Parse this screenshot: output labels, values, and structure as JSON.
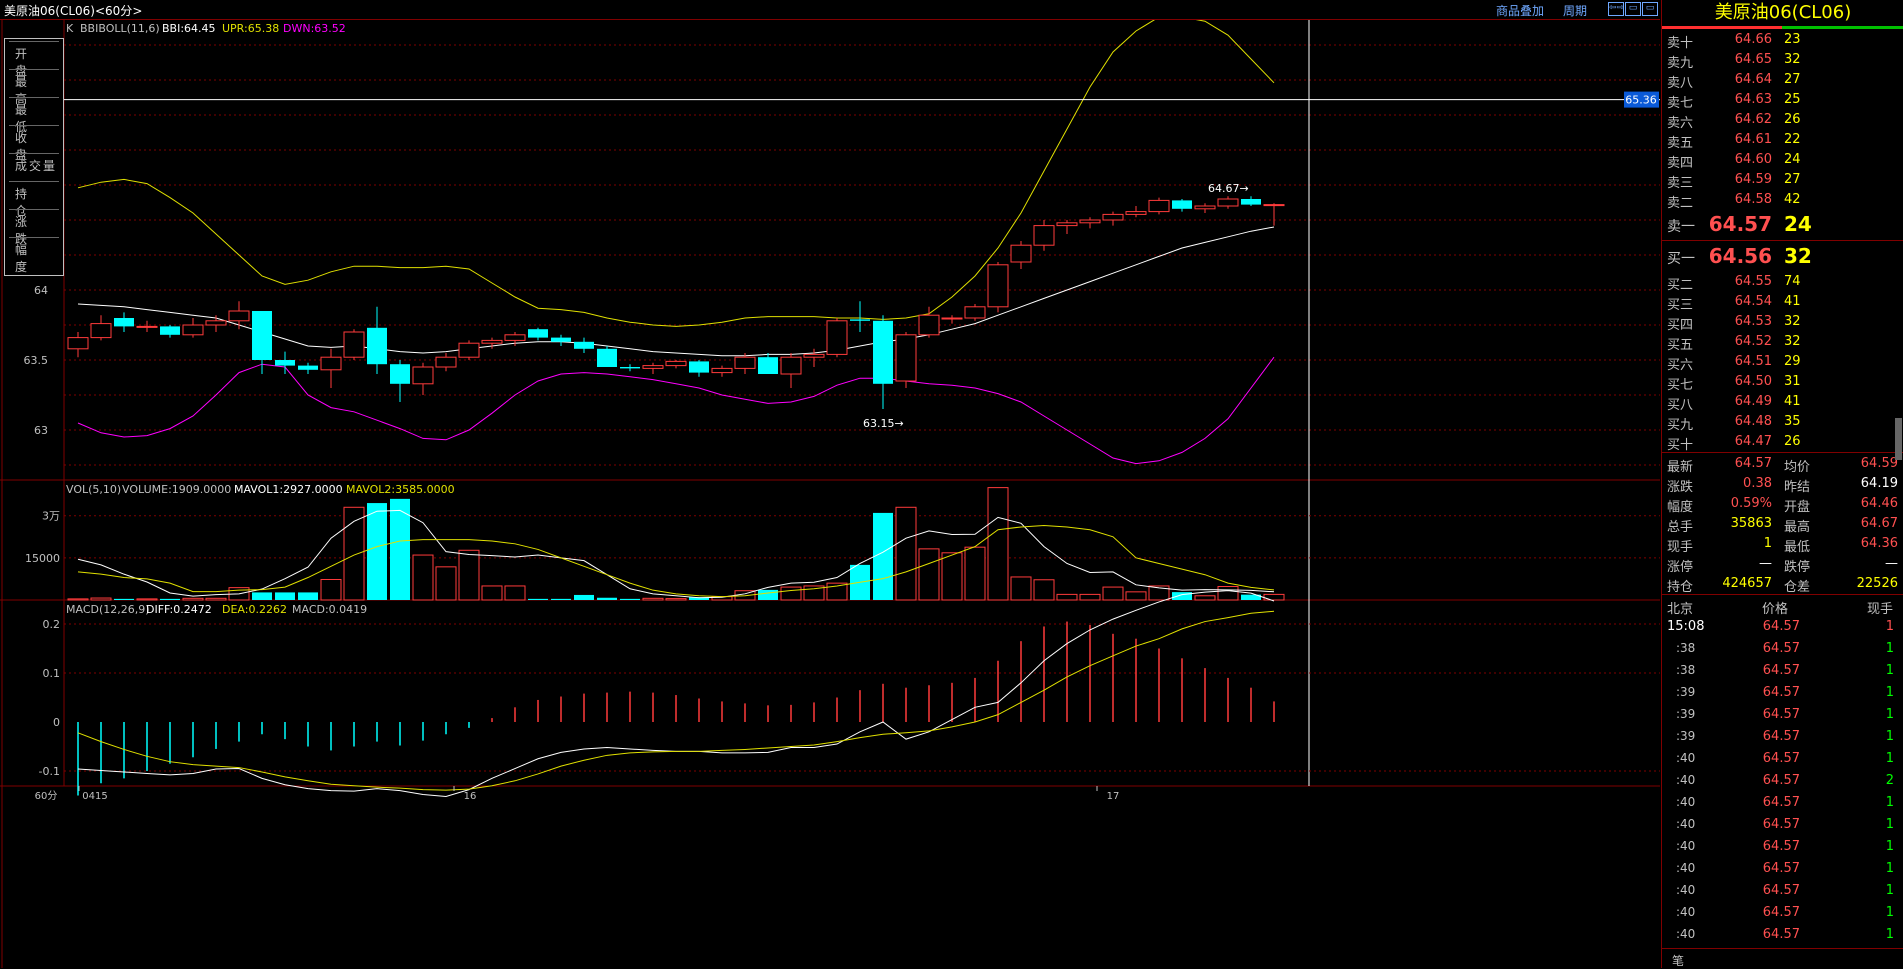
{
  "window": {
    "title": "美原油06(CL06)",
    "period": "60分",
    "overlay_label": "商品叠加",
    "cycle_label": "周期",
    "buttons": [
      "⇦⇨",
      "▭",
      "▭"
    ]
  },
  "infobox": [
    "开 盘",
    "最 高",
    "最 低",
    "收 盘",
    "成交量",
    "持 仓",
    "涨 跌",
    "幅 度"
  ],
  "indicators": {
    "main": {
      "name": "K",
      "sub": "BBIBOLL(11,6)",
      "bbi": "BBI:64.45",
      "upr": "UPR:65.38",
      "dwn": "DWN:63.52"
    },
    "vol": {
      "text": "VOL(5,10)",
      "volume": "VOLUME:1909.0000",
      "m1": "MAVOL1:2927.0000",
      "m2": "MAVOL2:3585.0000"
    },
    "macd": {
      "text": "MACD(12,26,9)",
      "diff": "DIFF:0.2472",
      "dea": "DEA:0.2262",
      "macd": "MACD:0.0419"
    }
  },
  "colors": {
    "up": "#ff3b3b",
    "down": "#00ffff",
    "bbi": "#ffffff",
    "upr": "#e0e000",
    "dwn": "#ff00ff",
    "grid": "#800000"
  },
  "chart_data": [
    {
      "type": "candlestick",
      "title": "美原油06(CL06) 60分",
      "xlabel": "",
      "ylabel": "",
      "x_tick_labels": [
        "0415",
        "16",
        "17"
      ],
      "period_label": "60分",
      "y_ticks": [
        63.0,
        63.5,
        64.0
      ],
      "ylim": [
        62.65,
        65.95
      ],
      "crosshair_value": "65.36",
      "annotations": [
        {
          "text": "64.67→",
          "x_index": 50,
          "value": 64.67
        },
        {
          "text": "63.15→",
          "x_index": 35,
          "value": 63.15
        }
      ],
      "candles": [
        [
          63.58,
          63.7,
          63.52,
          63.66
        ],
        [
          63.66,
          63.82,
          63.64,
          63.76
        ],
        [
          63.8,
          63.84,
          63.7,
          63.74
        ],
        [
          63.74,
          63.78,
          63.7,
          63.74
        ],
        [
          63.74,
          63.75,
          63.66,
          63.68
        ],
        [
          63.68,
          63.8,
          63.66,
          63.75
        ],
        [
          63.75,
          63.82,
          63.7,
          63.78
        ],
        [
          63.78,
          63.92,
          63.72,
          63.85
        ],
        [
          63.85,
          63.85,
          63.4,
          63.5
        ],
        [
          63.5,
          63.56,
          63.4,
          63.46
        ],
        [
          63.46,
          63.48,
          63.4,
          63.43
        ],
        [
          63.43,
          63.58,
          63.3,
          63.52
        ],
        [
          63.52,
          63.72,
          63.5,
          63.7
        ],
        [
          63.73,
          63.88,
          63.4,
          63.47
        ],
        [
          63.47,
          63.5,
          63.2,
          63.33
        ],
        [
          63.33,
          63.48,
          63.25,
          63.45
        ],
        [
          63.45,
          63.55,
          63.42,
          63.52
        ],
        [
          63.52,
          63.64,
          63.5,
          63.62
        ],
        [
          63.62,
          63.66,
          63.58,
          63.64
        ],
        [
          63.64,
          63.7,
          63.6,
          63.68
        ],
        [
          63.72,
          63.73,
          63.64,
          63.66
        ],
        [
          63.66,
          63.68,
          63.6,
          63.63
        ],
        [
          63.63,
          63.66,
          63.55,
          63.58
        ],
        [
          63.58,
          63.6,
          63.45,
          63.45
        ],
        [
          63.45,
          63.47,
          63.42,
          63.44
        ],
        [
          63.44,
          63.48,
          63.4,
          63.46
        ],
        [
          63.46,
          63.5,
          63.44,
          63.49
        ],
        [
          63.49,
          63.5,
          63.38,
          63.41
        ],
        [
          63.41,
          63.46,
          63.38,
          63.44
        ],
        [
          63.44,
          63.55,
          63.4,
          63.52
        ],
        [
          63.52,
          63.55,
          63.4,
          63.4
        ],
        [
          63.4,
          63.55,
          63.3,
          63.52
        ],
        [
          63.52,
          63.58,
          63.45,
          63.54
        ],
        [
          63.54,
          63.8,
          63.52,
          63.78
        ],
        [
          63.79,
          63.92,
          63.7,
          63.78
        ],
        [
          63.78,
          63.82,
          63.15,
          63.33
        ],
        [
          63.35,
          63.7,
          63.3,
          63.68
        ],
        [
          63.68,
          63.88,
          63.66,
          63.82
        ],
        [
          63.8,
          63.82,
          63.76,
          63.8
        ],
        [
          63.8,
          63.9,
          63.78,
          63.88
        ],
        [
          63.88,
          64.2,
          63.84,
          64.18
        ],
        [
          64.2,
          64.35,
          64.15,
          64.32
        ],
        [
          64.32,
          64.5,
          64.28,
          64.46
        ],
        [
          64.46,
          64.5,
          64.4,
          64.48
        ],
        [
          64.48,
          64.52,
          64.44,
          64.5
        ],
        [
          64.5,
          64.56,
          64.46,
          64.54
        ],
        [
          64.54,
          64.6,
          64.52,
          64.56
        ],
        [
          64.56,
          64.66,
          64.54,
          64.64
        ],
        [
          64.64,
          64.65,
          64.56,
          64.58
        ],
        [
          64.58,
          64.62,
          64.55,
          64.6
        ],
        [
          64.6,
          64.67,
          64.58,
          64.65
        ],
        [
          64.65,
          64.67,
          64.6,
          64.61
        ],
        [
          64.61,
          64.62,
          64.46,
          64.61
        ]
      ],
      "bbi": [
        63.9,
        63.89,
        63.88,
        63.86,
        63.84,
        63.82,
        63.8,
        63.75,
        63.7,
        63.65,
        63.6,
        63.59,
        63.6,
        63.58,
        63.56,
        63.55,
        63.56,
        63.58,
        63.6,
        63.62,
        63.63,
        63.63,
        63.62,
        63.6,
        63.58,
        63.56,
        63.55,
        63.54,
        63.53,
        63.53,
        63.54,
        63.54,
        63.55,
        63.57,
        63.6,
        63.63,
        63.65,
        63.68,
        63.72,
        63.76,
        63.82,
        63.88,
        63.94,
        64.0,
        64.06,
        64.12,
        64.18,
        64.24,
        64.3,
        64.34,
        64.38,
        64.42,
        64.45
      ],
      "upr": [
        64.73,
        64.77,
        64.79,
        64.76,
        64.66,
        64.55,
        64.4,
        64.25,
        64.1,
        64.04,
        64.07,
        64.13,
        64.17,
        64.17,
        64.16,
        64.16,
        64.17,
        64.15,
        64.05,
        63.95,
        63.87,
        63.86,
        63.84,
        63.8,
        63.77,
        63.75,
        63.74,
        63.75,
        63.77,
        63.8,
        63.81,
        63.81,
        63.81,
        63.8,
        63.8,
        63.79,
        63.8,
        63.83,
        63.95,
        64.1,
        64.3,
        64.55,
        64.85,
        65.15,
        65.45,
        65.7,
        65.85,
        65.95,
        65.95,
        65.92,
        65.82,
        65.65,
        65.48
      ],
      "dwn": [
        63.05,
        62.98,
        62.95,
        62.96,
        63.01,
        63.1,
        63.25,
        63.41,
        63.47,
        63.45,
        63.25,
        63.16,
        63.13,
        63.07,
        63.01,
        62.94,
        62.93,
        63.0,
        63.12,
        63.25,
        63.35,
        63.4,
        63.41,
        63.4,
        63.38,
        63.36,
        63.33,
        63.3,
        63.25,
        63.22,
        63.19,
        63.2,
        63.24,
        63.32,
        63.37,
        63.37,
        63.35,
        63.33,
        63.32,
        63.3,
        63.26,
        63.2,
        63.1,
        63.0,
        62.9,
        62.8,
        62.76,
        62.78,
        62.84,
        62.94,
        63.08,
        63.3,
        63.52
      ]
    },
    {
      "type": "bar",
      "title": "VOL(5,10)",
      "y_tick_labels": [
        "3万",
        "15000"
      ],
      "y_ticks": [
        30000,
        15000
      ],
      "ylim": [
        0,
        42000
      ],
      "values": [
        400,
        700,
        400,
        400,
        400,
        600,
        600,
        4400,
        2700,
        2700,
        2700,
        7300,
        33000,
        34500,
        36000,
        16000,
        11800,
        17700,
        5000,
        5000,
        400,
        400,
        1800,
        800,
        400,
        600,
        500,
        1000,
        1200,
        3300,
        3600,
        4600,
        5000,
        6000,
        12500,
        31000,
        33000,
        18200,
        16800,
        18800,
        40000,
        8200,
        7200,
        2000,
        2000,
        4600,
        2900,
        5000,
        2800,
        1500,
        4800,
        1909,
        2000
      ],
      "mavol1": [
        14500,
        12500,
        9200,
        6400,
        2500,
        1400,
        1900,
        2200,
        3900,
        7600,
        11700,
        22000,
        28000,
        31600,
        31900,
        27500,
        17200,
        16200,
        15800,
        15300,
        16000,
        15000,
        14000,
        9000,
        4000,
        2200,
        1500,
        800,
        1000,
        2200,
        4500,
        6000,
        6300,
        8000,
        13000,
        17000,
        22000,
        24600,
        23300,
        23400,
        29400,
        27300,
        19000,
        13000,
        9800,
        10000,
        5400,
        4300,
        3500,
        3700,
        3600,
        3427,
        2927
      ],
      "mavol2": [
        10000,
        9200,
        8000,
        7500,
        6000,
        3000,
        3000,
        3500,
        3700,
        4600,
        8000,
        12000,
        16000,
        19000,
        21000,
        21500,
        21500,
        21500,
        21000,
        20000,
        18000,
        15000,
        12000,
        9000,
        6000,
        3500,
        2200,
        1500,
        1200,
        1500,
        2500,
        3400,
        4000,
        5000,
        6300,
        7600,
        10000,
        13000,
        16000,
        19000,
        25000,
        26000,
        26500,
        26000,
        25000,
        22500,
        15000,
        13000,
        11000,
        9000,
        6000,
        4500,
        3585
      ]
    },
    {
      "type": "bar",
      "title": "MACD(12,26,9)",
      "y_ticks": [
        0.2,
        0.1,
        0,
        -0.1
      ],
      "ylim": [
        -0.16,
        0.28
      ],
      "macd": [
        -0.15,
        -0.125,
        -0.115,
        -0.1,
        -0.085,
        -0.072,
        -0.055,
        -0.04,
        -0.025,
        -0.035,
        -0.05,
        -0.058,
        -0.05,
        -0.04,
        -0.048,
        -0.038,
        -0.025,
        -0.012,
        0.008,
        0.03,
        0.045,
        0.052,
        0.058,
        0.06,
        0.062,
        0.06,
        0.055,
        0.048,
        0.042,
        0.038,
        0.034,
        0.035,
        0.04,
        0.05,
        0.065,
        0.078,
        0.07,
        0.075,
        0.08,
        0.09,
        0.125,
        0.165,
        0.195,
        0.205,
        0.198,
        0.18,
        0.17,
        0.15,
        0.13,
        0.11,
        0.09,
        0.07,
        0.042
      ],
      "diff": [
        -0.096,
        -0.099,
        -0.102,
        -0.105,
        -0.108,
        -0.105,
        -0.096,
        -0.095,
        -0.115,
        -0.128,
        -0.136,
        -0.14,
        -0.141,
        -0.136,
        -0.14,
        -0.148,
        -0.152,
        -0.138,
        -0.115,
        -0.095,
        -0.075,
        -0.062,
        -0.055,
        -0.052,
        -0.055,
        -0.058,
        -0.06,
        -0.06,
        -0.063,
        -0.063,
        -0.062,
        -0.052,
        -0.052,
        -0.045,
        -0.02,
        0.0,
        -0.035,
        -0.02,
        0.005,
        0.03,
        0.04,
        0.08,
        0.125,
        0.16,
        0.188,
        0.21,
        0.228,
        0.245,
        0.26,
        0.265,
        0.268,
        0.263,
        0.247
      ],
      "dea": [
        -0.022,
        -0.04,
        -0.056,
        -0.07,
        -0.081,
        -0.087,
        -0.09,
        -0.093,
        -0.102,
        -0.112,
        -0.12,
        -0.127,
        -0.13,
        -0.133,
        -0.135,
        -0.138,
        -0.139,
        -0.137,
        -0.13,
        -0.12,
        -0.106,
        -0.09,
        -0.078,
        -0.068,
        -0.063,
        -0.061,
        -0.06,
        -0.06,
        -0.058,
        -0.056,
        -0.053,
        -0.05,
        -0.047,
        -0.04,
        -0.032,
        -0.025,
        -0.022,
        -0.018,
        -0.01,
        0.0,
        0.015,
        0.04,
        0.065,
        0.092,
        0.115,
        0.135,
        0.155,
        0.17,
        0.19,
        0.205,
        0.213,
        0.222,
        0.226
      ]
    }
  ],
  "right_panel": {
    "title": "美原油06(CL06)",
    "asks": [
      {
        "label": "卖十",
        "price": "64.66",
        "vol": "23"
      },
      {
        "label": "卖九",
        "price": "64.65",
        "vol": "32"
      },
      {
        "label": "卖八",
        "price": "64.64",
        "vol": "27"
      },
      {
        "label": "卖七",
        "price": "64.63",
        "vol": "25"
      },
      {
        "label": "卖六",
        "price": "64.62",
        "vol": "26"
      },
      {
        "label": "卖五",
        "price": "64.61",
        "vol": "22"
      },
      {
        "label": "卖四",
        "price": "64.60",
        "vol": "24"
      },
      {
        "label": "卖三",
        "price": "64.59",
        "vol": "27"
      },
      {
        "label": "卖二",
        "price": "64.58",
        "vol": "42"
      },
      {
        "label": "卖一",
        "price": "64.57",
        "vol": "24"
      }
    ],
    "bids": [
      {
        "label": "买一",
        "price": "64.56",
        "vol": "32"
      },
      {
        "label": "买二",
        "price": "64.55",
        "vol": "74"
      },
      {
        "label": "买三",
        "price": "64.54",
        "vol": "41"
      },
      {
        "label": "买四",
        "price": "64.53",
        "vol": "32"
      },
      {
        "label": "买五",
        "price": "64.52",
        "vol": "32"
      },
      {
        "label": "买六",
        "price": "64.51",
        "vol": "29"
      },
      {
        "label": "买七",
        "price": "64.50",
        "vol": "31"
      },
      {
        "label": "买八",
        "price": "64.49",
        "vol": "41"
      },
      {
        "label": "买九",
        "price": "64.48",
        "vol": "35"
      },
      {
        "label": "买十",
        "price": "64.47",
        "vol": "26"
      }
    ],
    "stats": [
      {
        "a": "最新",
        "b": "64.57",
        "bc": "#ff5050",
        "c": "均价",
        "d": "64.59",
        "dc": "#ff5050"
      },
      {
        "a": "涨跌",
        "b": "0.38",
        "bc": "#ff5050",
        "c": "昨结",
        "d": "64.19",
        "dc": "#ffffff"
      },
      {
        "a": "幅度",
        "b": "0.59%",
        "bc": "#ff5050",
        "c": "开盘",
        "d": "64.46",
        "dc": "#ff5050"
      },
      {
        "a": "总手",
        "b": "35863",
        "bc": "#ffff00",
        "c": "最高",
        "d": "64.67",
        "dc": "#ff5050"
      },
      {
        "a": "现手",
        "b": "1",
        "bc": "#ffff00",
        "c": "最低",
        "d": "64.36",
        "dc": "#ff5050"
      },
      {
        "a": "涨停",
        "b": "—",
        "bc": "#ffffff",
        "c": "跌停",
        "d": "—",
        "dc": "#ffffff"
      },
      {
        "a": "持仓",
        "b": "424657",
        "bc": "#ffff00",
        "c": "仓差",
        "d": "22526",
        "dc": "#ffff00"
      }
    ],
    "ticks_header": {
      "time": "北京",
      "price": "价格",
      "qty": "现手"
    },
    "ticks": [
      {
        "time": "15:08",
        "price": "64.57",
        "qty": "1",
        "qc": "#ff5050"
      },
      {
        "time": ":38",
        "price": "64.57",
        "qty": "1",
        "qc": "#00ff00"
      },
      {
        "time": ":38",
        "price": "64.57",
        "qty": "1",
        "qc": "#00ff00"
      },
      {
        "time": ":39",
        "price": "64.57",
        "qty": "1",
        "qc": "#00ff00"
      },
      {
        "time": ":39",
        "price": "64.57",
        "qty": "1",
        "qc": "#00ff00"
      },
      {
        "time": ":39",
        "price": "64.57",
        "qty": "1",
        "qc": "#00ff00"
      },
      {
        "time": ":40",
        "price": "64.57",
        "qty": "1",
        "qc": "#00ff00"
      },
      {
        "time": ":40",
        "price": "64.57",
        "qty": "2",
        "qc": "#00ff00"
      },
      {
        "time": ":40",
        "price": "64.57",
        "qty": "1",
        "qc": "#00ff00"
      },
      {
        "time": ":40",
        "price": "64.57",
        "qty": "1",
        "qc": "#00ff00"
      },
      {
        "time": ":40",
        "price": "64.57",
        "qty": "1",
        "qc": "#00ff00"
      },
      {
        "time": ":40",
        "price": "64.57",
        "qty": "1",
        "qc": "#00ff00"
      },
      {
        "time": ":40",
        "price": "64.57",
        "qty": "1",
        "qc": "#00ff00"
      },
      {
        "time": ":40",
        "price": "64.57",
        "qty": "1",
        "qc": "#00ff00"
      },
      {
        "time": ":40",
        "price": "64.57",
        "qty": "1",
        "qc": "#00ff00"
      }
    ],
    "footer_tab": "笔"
  }
}
